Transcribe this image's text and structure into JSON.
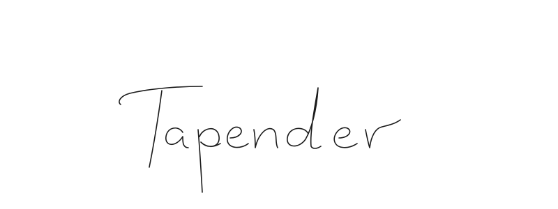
{
  "signature": {
    "text": "Tapender",
    "ink_color": "#1a1a1a"
  },
  "background_color": "#ffffff"
}
